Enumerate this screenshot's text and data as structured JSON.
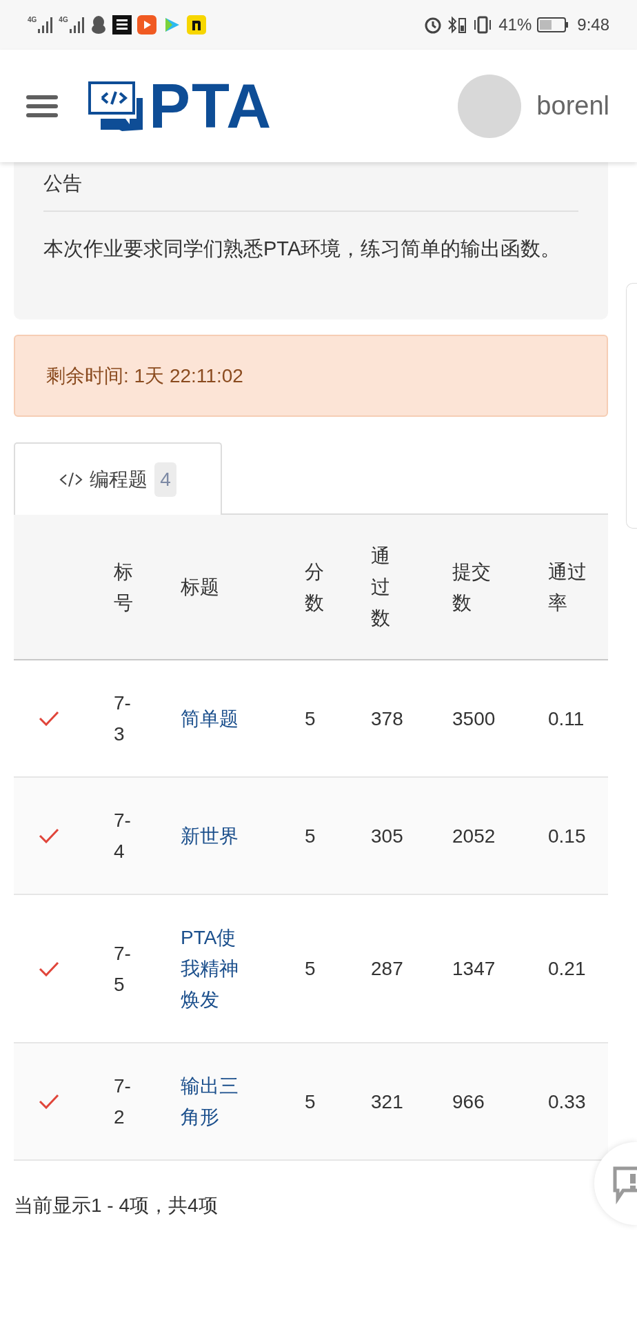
{
  "status_bar": {
    "signal_labels": [
      "4G",
      "4G"
    ],
    "battery": "41%",
    "time": "9:48"
  },
  "header": {
    "logo": "PTA",
    "user": "borenl"
  },
  "notice": {
    "title": "公告",
    "body": "本次作业要求同学们熟悉PTA环境，练习简单的输出函数。"
  },
  "timer": "剩余时间: 1天 22:11:02",
  "tabs": [
    {
      "label": "编程题",
      "count": "4",
      "selected": true
    }
  ],
  "table": {
    "columns": [
      "",
      "标号",
      "标题",
      "分数",
      "通过数",
      "提交数",
      "通过率"
    ],
    "rows": [
      {
        "passed": true,
        "number": "7-3",
        "title": "简单题",
        "score": "5",
        "accepted": "378",
        "submitted": "3500",
        "rate": "0.11"
      },
      {
        "passed": true,
        "number": "7-4",
        "title": "新世界",
        "score": "5",
        "accepted": "305",
        "submitted": "2052",
        "rate": "0.15"
      },
      {
        "passed": true,
        "number": "7-5",
        "title": "PTA使我精神焕发",
        "score": "5",
        "accepted": "287",
        "submitted": "1347",
        "rate": "0.21"
      },
      {
        "passed": true,
        "number": "7-2",
        "title": "输出三角形",
        "score": "5",
        "accepted": "321",
        "submitted": "966",
        "rate": "0.33"
      }
    ]
  },
  "footer": "当前显示1 - 4项，共4项"
}
